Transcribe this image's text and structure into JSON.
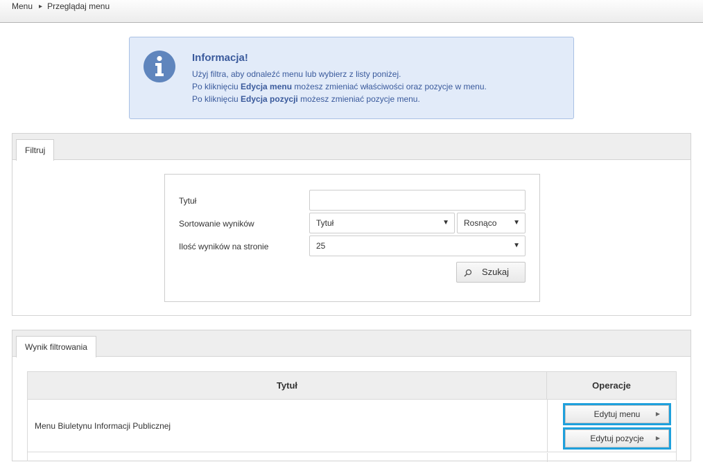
{
  "breadcrumb": {
    "items": [
      "Menu",
      "Przeglądaj menu"
    ]
  },
  "info": {
    "title": "Informacja!",
    "line1": "Użyj filtra, aby odnaleźć menu lub wybierz z listy poniżej.",
    "line2_pre": "Po kliknięciu ",
    "line2_bold": "Edycja menu",
    "line2_post": " możesz zmieniać właściwości oraz pozycje w menu.",
    "line3_pre": "Po kliknięciu ",
    "line3_bold": "Edycja pozycji",
    "line3_post": " możesz zmieniać pozycje menu."
  },
  "filter": {
    "tab_label": "Filtruj",
    "title_label": "Tytuł",
    "title_value": "",
    "sort_label": "Sortowanie wyników",
    "sort_field_value": "Tytuł",
    "sort_order_value": "Rosnąco",
    "per_page_label": "Ilość wyników na stronie",
    "per_page_value": "25",
    "search_label": "Szukaj"
  },
  "results": {
    "tab_label": "Wynik filtrowania",
    "columns": [
      "Tytuł",
      "Operacje"
    ],
    "rows": [
      {
        "title": "Menu Biuletynu Informacji Publicznej",
        "edit_menu_label": "Edytuj menu",
        "edit_items_label": "Edytuj pozycje"
      }
    ]
  },
  "icons": {
    "info": "info-icon",
    "search": "search-icon",
    "dropdown": "chevron-down-icon",
    "breadcrumb_sep": "chevron-right-icon"
  },
  "colors": {
    "info_bg": "#e2ebf9",
    "info_text": "#3a5a9c",
    "highlight": "#1ea0dc"
  }
}
